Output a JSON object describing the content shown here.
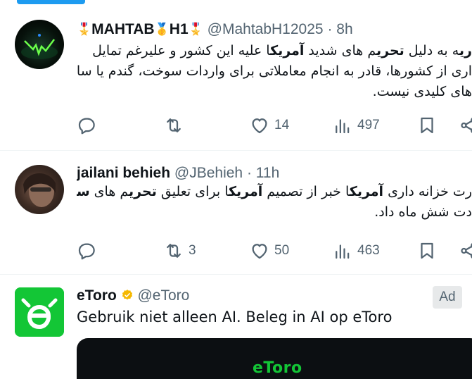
{
  "tweets": [
    {
      "display_name": "MAHTAB",
      "name_suffix": "H1",
      "medals": [
        "🎖️",
        "🥇",
        "🎖️"
      ],
      "handle": "@MahtabH12025",
      "separator": "·",
      "time": "8h",
      "lines": [
        [
          "ری",
          "ه به دلیل ",
          "تحری",
          "م های شدید ",
          "آمریک",
          "ا علیه این کشور و علیرغم تمایل"
        ],
        [
          "اری از کشورها، قادر به انجام معاملاتی برای واردات سوخت، گندم یا سایر"
        ],
        [
          "های کلیدی نیست."
        ]
      ],
      "actions": {
        "replies": "",
        "retweets": "",
        "likes": "14",
        "views": "497"
      }
    },
    {
      "display_name": "jailani behieh",
      "handle": "@JBehieh",
      "separator": "·",
      "time": "11h",
      "lines": [
        [
          "رت خزانه داری ",
          "آمریک",
          "ا خبر از تصمیم ",
          "آمریک",
          "ا برای تعلیق ",
          "تحری",
          "م های ",
          "سور"
        ],
        [
          "دت شش ماه داد."
        ]
      ],
      "actions": {
        "replies": "",
        "retweets": "3",
        "likes": "50",
        "views": "463"
      }
    }
  ],
  "ad": {
    "display_name": "eToro",
    "handle": "@eToro",
    "badge": "Ad",
    "text": "Gebruik niet alleen AI. Beleg in AI op eToro",
    "media_logo": "eToro",
    "brand_color": "#13c636"
  },
  "colors": {
    "accent": "#1d9bf0",
    "muted": "#536471",
    "text": "#0f1419",
    "verified_gold": "#f5b800"
  },
  "icons": [
    "reply-icon",
    "retweet-icon",
    "like-icon",
    "views-icon",
    "bookmark-icon",
    "share-icon",
    "verified-gold-icon"
  ]
}
